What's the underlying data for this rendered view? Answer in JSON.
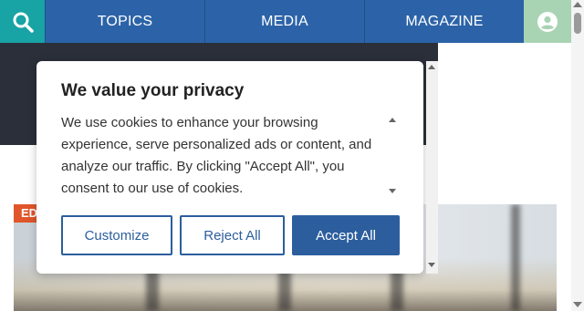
{
  "nav": {
    "items": [
      {
        "label": "TOPICS"
      },
      {
        "label": "MEDIA"
      },
      {
        "label": "MAGAZINE"
      }
    ],
    "search_icon": "search-icon",
    "account_icon": "user-avatar-icon"
  },
  "article": {
    "category_badge": "ED"
  },
  "consent": {
    "title": "We value your privacy",
    "body": "We use cookies to enhance your browsing experience, serve personalized ads or content, and analyze our traffic. By clicking \"Accept All\", you consent to our use of cookies.",
    "buttons": {
      "customize": "Customize",
      "reject": "Reject All",
      "accept": "Accept All"
    }
  },
  "colors": {
    "nav_blue": "#2c63a8",
    "search_teal": "#18a3a4",
    "account_green": "#a8d4b4",
    "dark_band": "#2b2f3a",
    "button_blue": "#2c5e9e",
    "badge_orange": "#e0562a"
  }
}
